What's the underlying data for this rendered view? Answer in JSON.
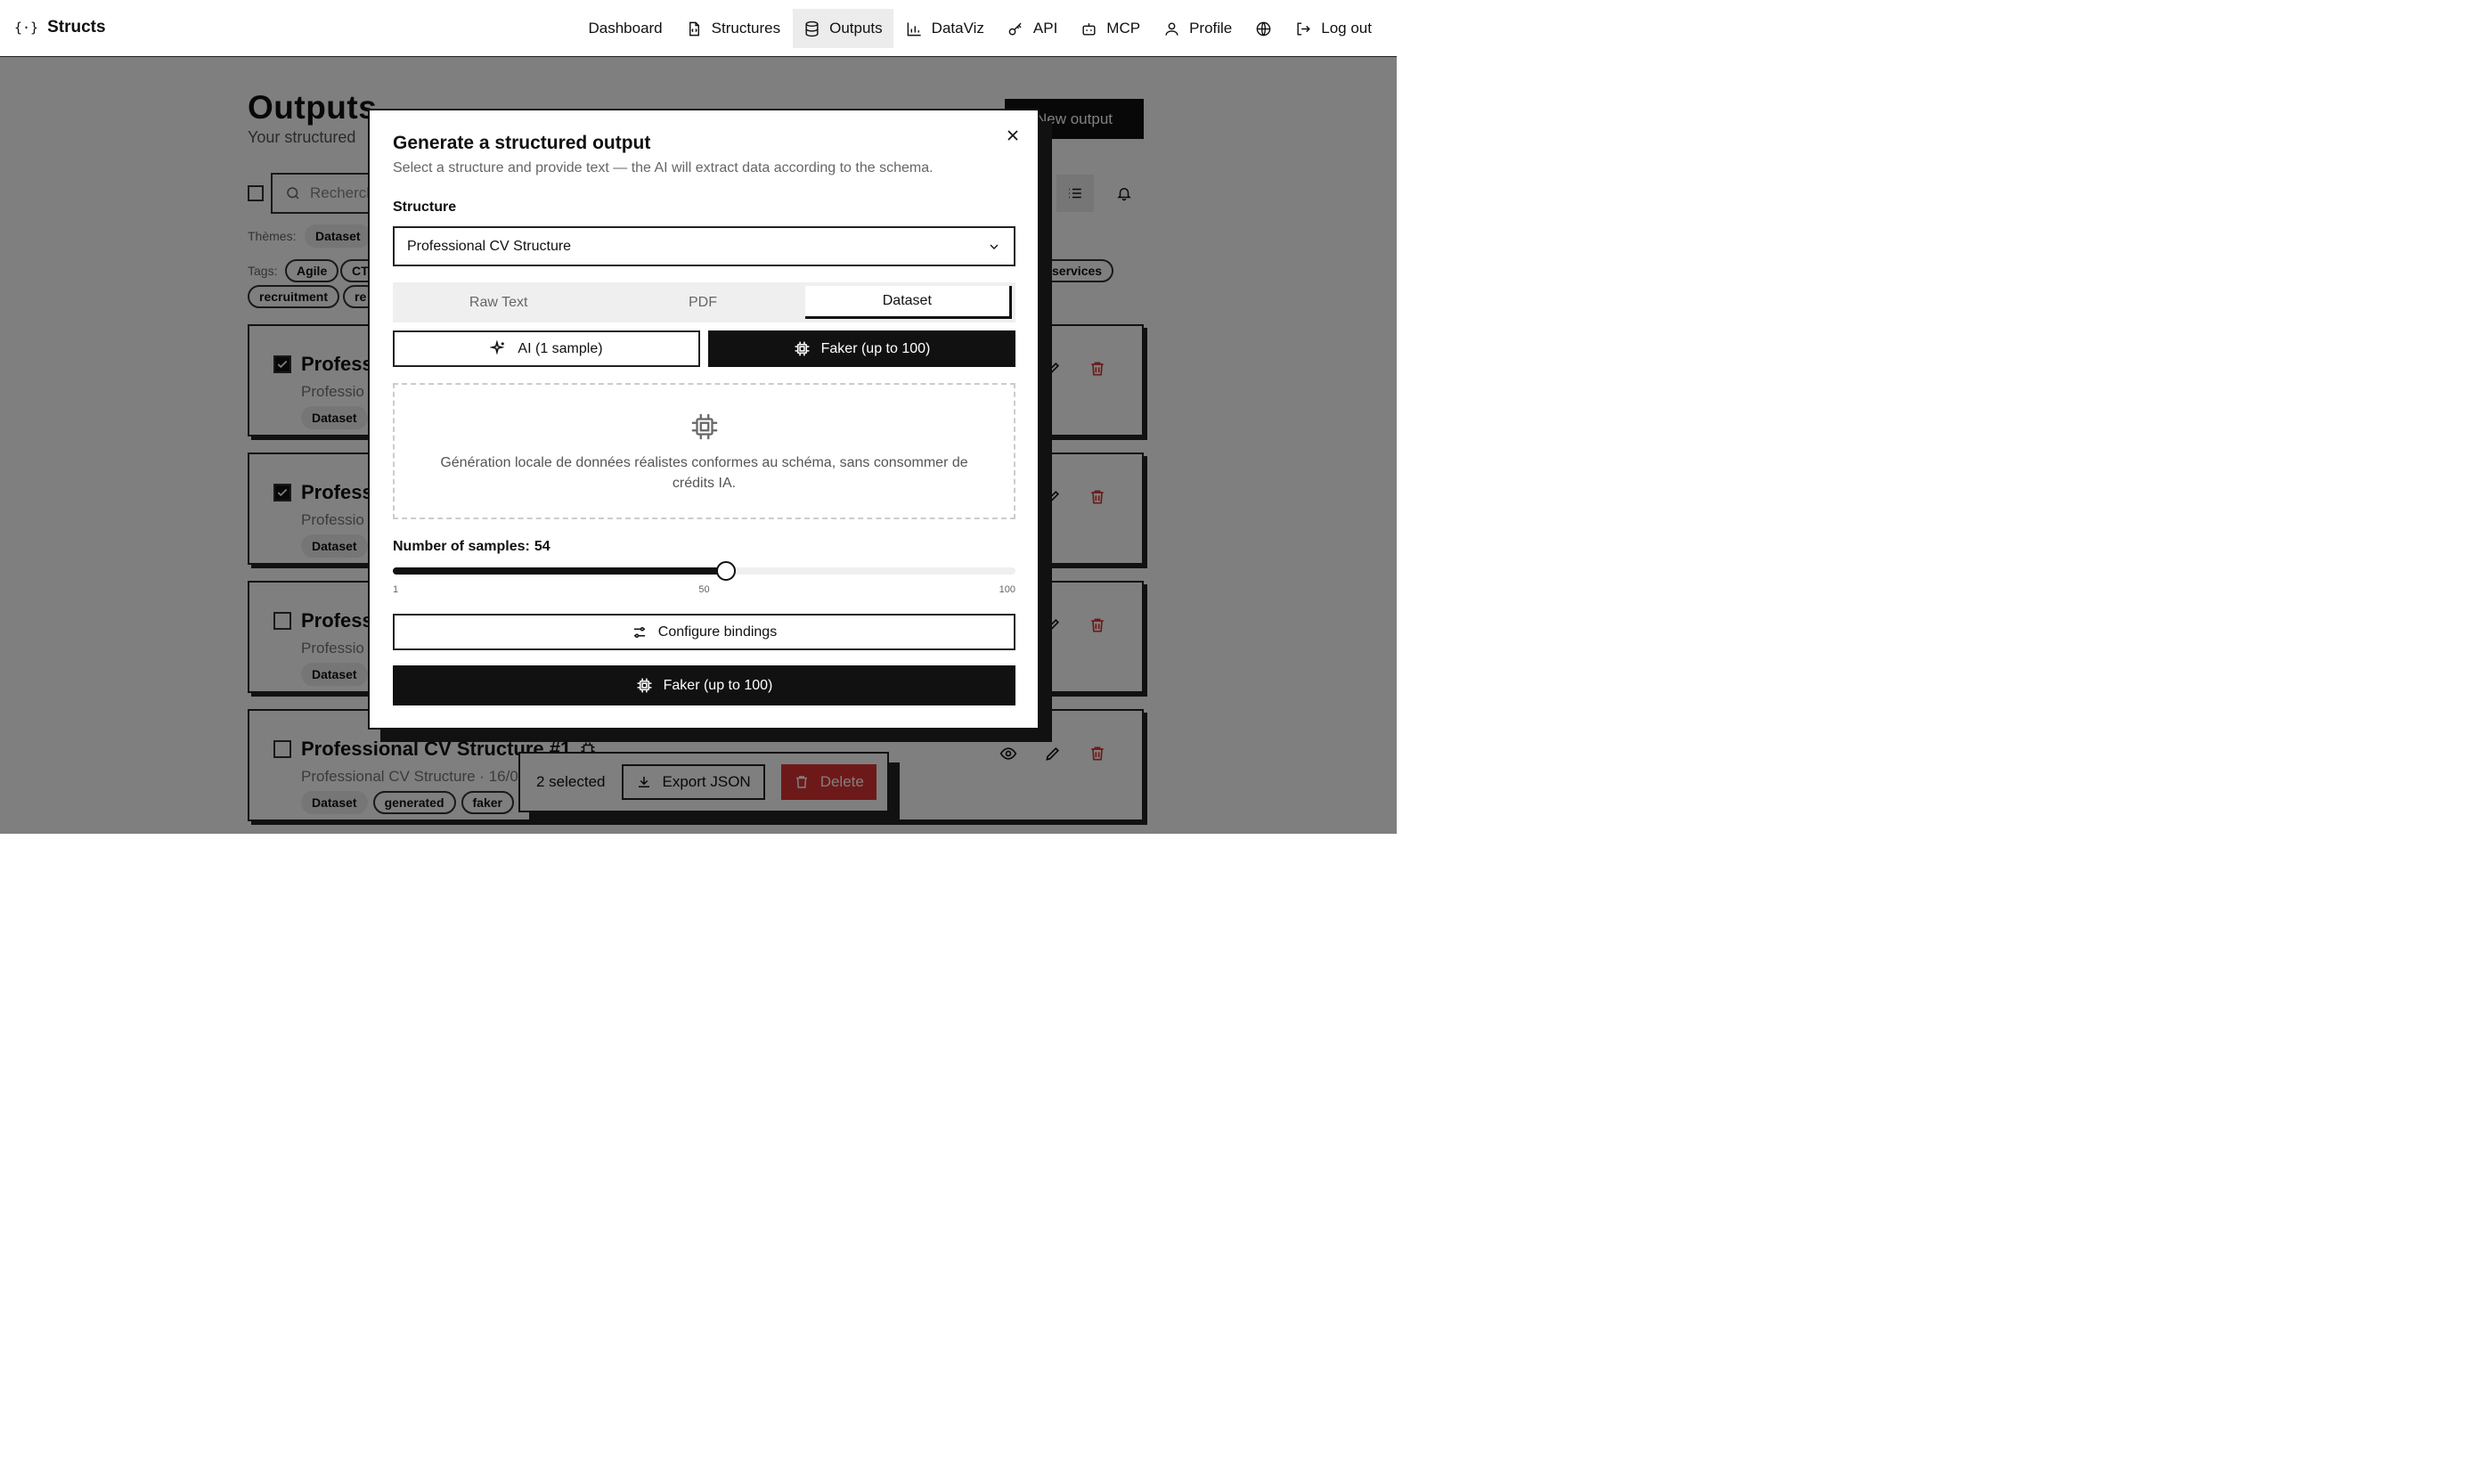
{
  "nav": {
    "brand_logo": "{·}",
    "brand": "Structs",
    "items": [
      {
        "label": "Dashboard",
        "icon": "none"
      },
      {
        "label": "Structures",
        "icon": "file-icon"
      },
      {
        "label": "Outputs",
        "icon": "database-icon",
        "active": true
      },
      {
        "label": "DataViz",
        "icon": "bar-chart-icon"
      },
      {
        "label": "API",
        "icon": "key-icon"
      },
      {
        "label": "MCP",
        "icon": "bot-icon"
      },
      {
        "label": "Profile",
        "icon": "user-icon"
      },
      {
        "label": "",
        "icon": "globe-icon"
      },
      {
        "label": "Log out",
        "icon": "logout-icon"
      }
    ]
  },
  "page": {
    "title": "Outputs",
    "subtitle": "Your structured",
    "new_output": "New output",
    "search_placeholder": "Recherch",
    "themes_label": "Thèmes:",
    "theme_chip": "Dataset",
    "tags_label": "Tags:",
    "tags": [
      "Agile",
      "CTC",
      "services",
      "recruitment",
      "re"
    ]
  },
  "cards": [
    {
      "title": "Professi",
      "meta": "Professio",
      "chip": "Dataset",
      "checked": true
    },
    {
      "title": "Professi",
      "meta": "Professio",
      "chip": "Dataset",
      "checked": true
    },
    {
      "title": "Professi",
      "meta": "Professio",
      "chip": "Dataset",
      "checked": false
    },
    {
      "title": "Professional CV Structure #1",
      "meta": "Professional CV Structure  ·  16/0",
      "chip": "Dataset",
      "chip2": "generated",
      "chip3": "faker",
      "checked": false
    }
  ],
  "bulk": {
    "count": "2 selected",
    "export": "Export JSON",
    "delete": "Delete"
  },
  "modal": {
    "title": "Generate a structured output",
    "description": "Select a structure and provide text — the AI will extract data according to the schema.",
    "structure_label": "Structure",
    "structure_value": "Professional CV Structure",
    "tabs": [
      "Raw Text",
      "PDF",
      "Dataset"
    ],
    "active_tab": "Dataset",
    "mode_ai": "AI (1 sample)",
    "mode_faker": "Faker (up to 100)",
    "info_text": "Génération locale de données réalistes conformes au schéma, sans consommer de crédits IA.",
    "samples_label": "Number of samples:",
    "samples_value": "54",
    "slider": {
      "min": 1,
      "max": 100,
      "value": 54
    },
    "ticks": [
      "1",
      "50",
      "100"
    ],
    "configure": "Configure bindings",
    "submit": "Faker (up to 100)"
  },
  "colors": {
    "accent": "#111111",
    "danger": "#dd3333",
    "overlay": "rgba(0,0,0,0.5)"
  }
}
